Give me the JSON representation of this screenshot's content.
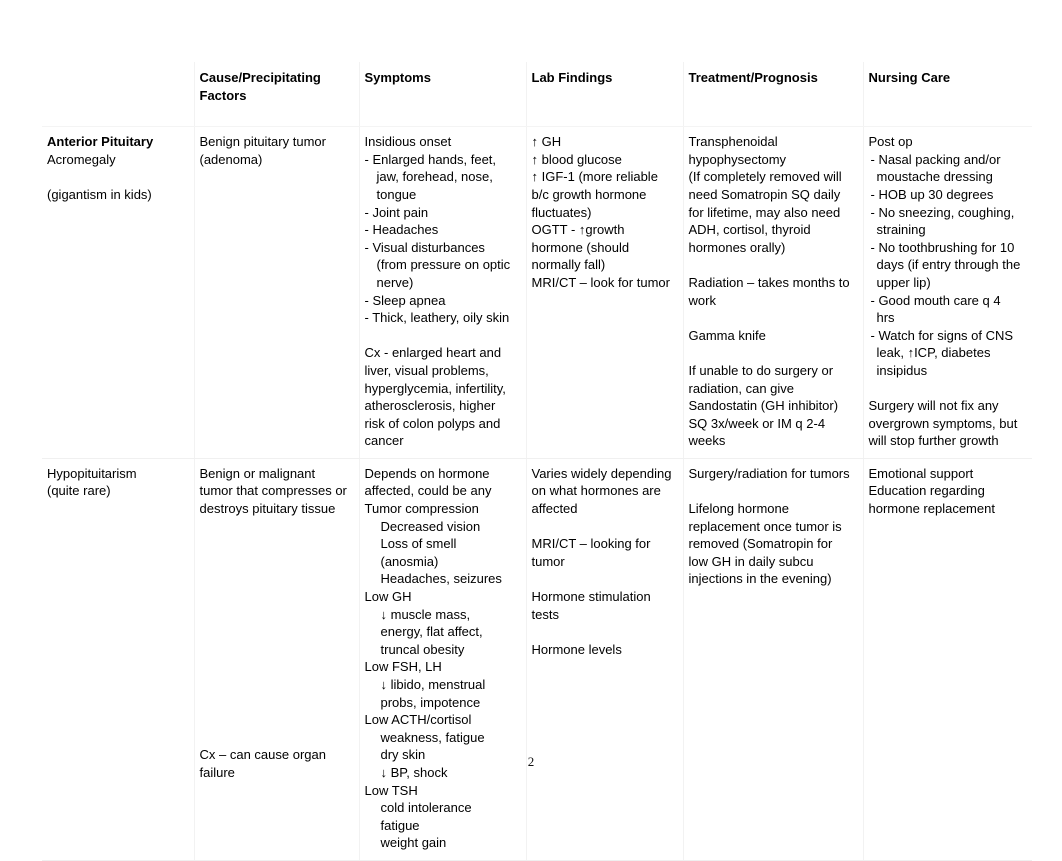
{
  "document": {
    "page_number": "2",
    "table": {
      "headers": [
        "",
        "Cause/Precipitating Factors",
        "Symptoms",
        "Lab Findings",
        "Treatment/Prognosis",
        "Nursing Care"
      ],
      "rows": [
        {
          "condition": {
            "title": "Anterior Pituitary",
            "name": "Acromegaly",
            "note": "(gigantism in kids)"
          },
          "cause": "Benign pituitary tumor (adenoma)",
          "symptoms": {
            "lead": "Insidious onset",
            "bullets": [
              "- Enlarged hands, feet, jaw, forehead, nose, tongue",
              "- Joint pain",
              "- Headaches",
              "- Visual disturbances (from pressure on optic nerve)",
              "- Sleep apnea",
              "- Thick, leathery, oily skin"
            ],
            "complications": "Cx - enlarged heart and liver, visual problems, hyperglycemia, infertility, atherosclerosis, higher risk of colon polyps and cancer"
          },
          "labs": {
            "items": [
              "↑ GH",
              "↑ blood glucose",
              "↑ IGF-1 (more reliable b/c growth hormone fluctuates)",
              "OGTT - ↑growth hormone (should normally fall)",
              "MRI/CT – look for tumor"
            ]
          },
          "treatment": {
            "paragraphs": [
              "Transphenoidal hypophysectomy",
              " (If completely removed will need Somatropin SQ daily for lifetime, may also need ADH, cortisol, thyroid hormones orally)",
              "Radiation – takes months to work",
              "Gamma knife",
              "If unable to do surgery or radiation, can give Sandostatin (GH inhibitor) SQ 3x/week or IM q 2-4 weeks"
            ]
          },
          "nursing": {
            "lead": "Post op",
            "bullets": [
              "- Nasal packing and/or moustache dressing",
              "- HOB up 30 degrees",
              "- No sneezing, coughing, straining",
              "- No toothbrushing for 10 days (if entry through the upper lip)",
              "- Good mouth care q 4 hrs",
              "- Watch for signs of CNS leak, ↑ICP, diabetes insipidus"
            ],
            "closing": "Surgery will not fix any overgrown symptoms, but will stop further growth"
          }
        },
        {
          "condition": {
            "name": "Hypopituitarism",
            "note": "(quite rare)"
          },
          "cause": "Benign or malignant tumor that compresses or destroys pituitary tissue",
          "cause_complication": "Cx – can cause organ failure",
          "symptoms": {
            "lead1": "Depends on hormone affected, could be any",
            "groups": [
              {
                "heading": "Tumor compression",
                "items": [
                  "Decreased vision",
                  "Loss of smell (anosmia)",
                  "Headaches, seizures"
                ]
              },
              {
                "heading": "Low GH",
                "items": [
                  "↓ muscle mass, energy, flat affect, truncal obesity"
                ]
              },
              {
                "heading": "Low FSH, LH",
                "items": [
                  "↓ libido, menstrual probs, impotence"
                ]
              },
              {
                "heading": "Low ACTH/cortisol",
                "items": [
                  "weakness, fatigue",
                  "dry skin",
                  "↓ BP, shock"
                ]
              },
              {
                "heading": "Low TSH",
                "items": [
                  "cold intolerance",
                  "fatigue",
                  "weight gain"
                ]
              }
            ]
          },
          "labs": {
            "items": [
              "Varies widely depending on what hormones are affected",
              "MRI/CT – looking for tumor",
              "Hormone stimulation tests",
              "Hormone levels"
            ]
          },
          "treatment": {
            "paragraphs": [
              "Surgery/radiation for tumors",
              "Lifelong hormone replacement once tumor is removed (Somatropin for low GH in daily subcu injections in the evening)"
            ]
          },
          "nursing": {
            "lines": [
              "Emotional support",
              "Education regarding hormone replacement"
            ]
          }
        }
      ]
    }
  }
}
